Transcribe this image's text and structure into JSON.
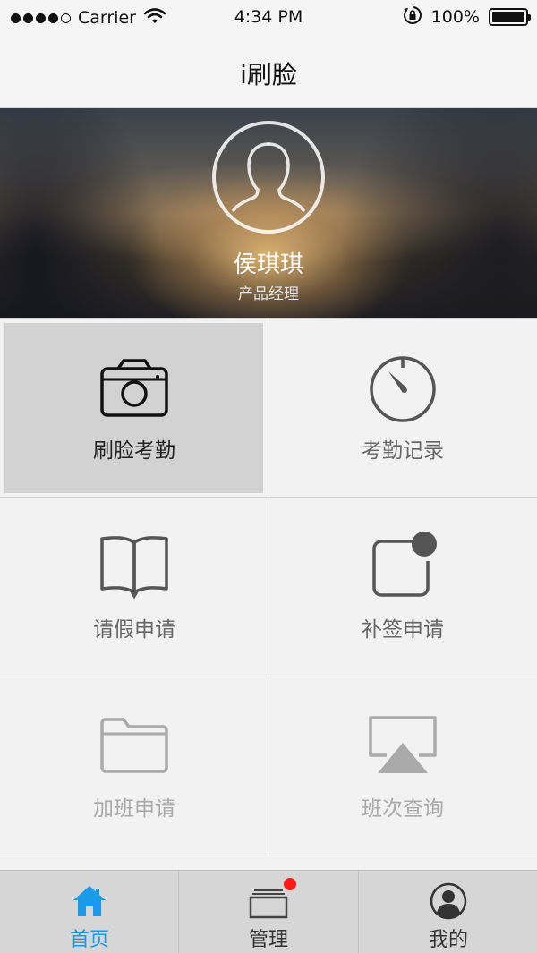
{
  "status_bar": {
    "carrier": "Carrier",
    "time": "4:34 PM",
    "battery_percent": "100%",
    "battery_level": 1.0,
    "signal_bars": 4,
    "icons": [
      "signal-icon",
      "wifi-icon",
      "orientation-lock-icon",
      "battery-icon"
    ]
  },
  "nav": {
    "title": "i刷脸"
  },
  "profile": {
    "name": "侯琪琪",
    "role": "产品经理",
    "avatar_icon": "user-avatar-icon"
  },
  "grid": {
    "items": [
      {
        "label": "刷脸考勤",
        "icon": "camera-icon",
        "selected": true
      },
      {
        "label": "考勤记录",
        "icon": "stopwatch-icon",
        "selected": false
      },
      {
        "label": "请假申请",
        "icon": "book-icon",
        "selected": false
      },
      {
        "label": "补签申请",
        "icon": "notification-square-icon",
        "selected": false
      },
      {
        "label": "加班申请",
        "icon": "folder-icon",
        "selected": false
      },
      {
        "label": "班次查询",
        "icon": "airplay-icon",
        "selected": false
      }
    ]
  },
  "tabs": [
    {
      "label": "首页",
      "icon": "home-icon",
      "active": true
    },
    {
      "label": "管理",
      "icon": "cards-icon",
      "active": false,
      "badge": true
    },
    {
      "label": "我的",
      "icon": "profile-icon",
      "active": false
    }
  ],
  "colors": {
    "accent": "#1a9ae8",
    "badge": "#ff1a1a",
    "selected_cell": "#d2d2d2",
    "background": "#f2f2f2"
  }
}
